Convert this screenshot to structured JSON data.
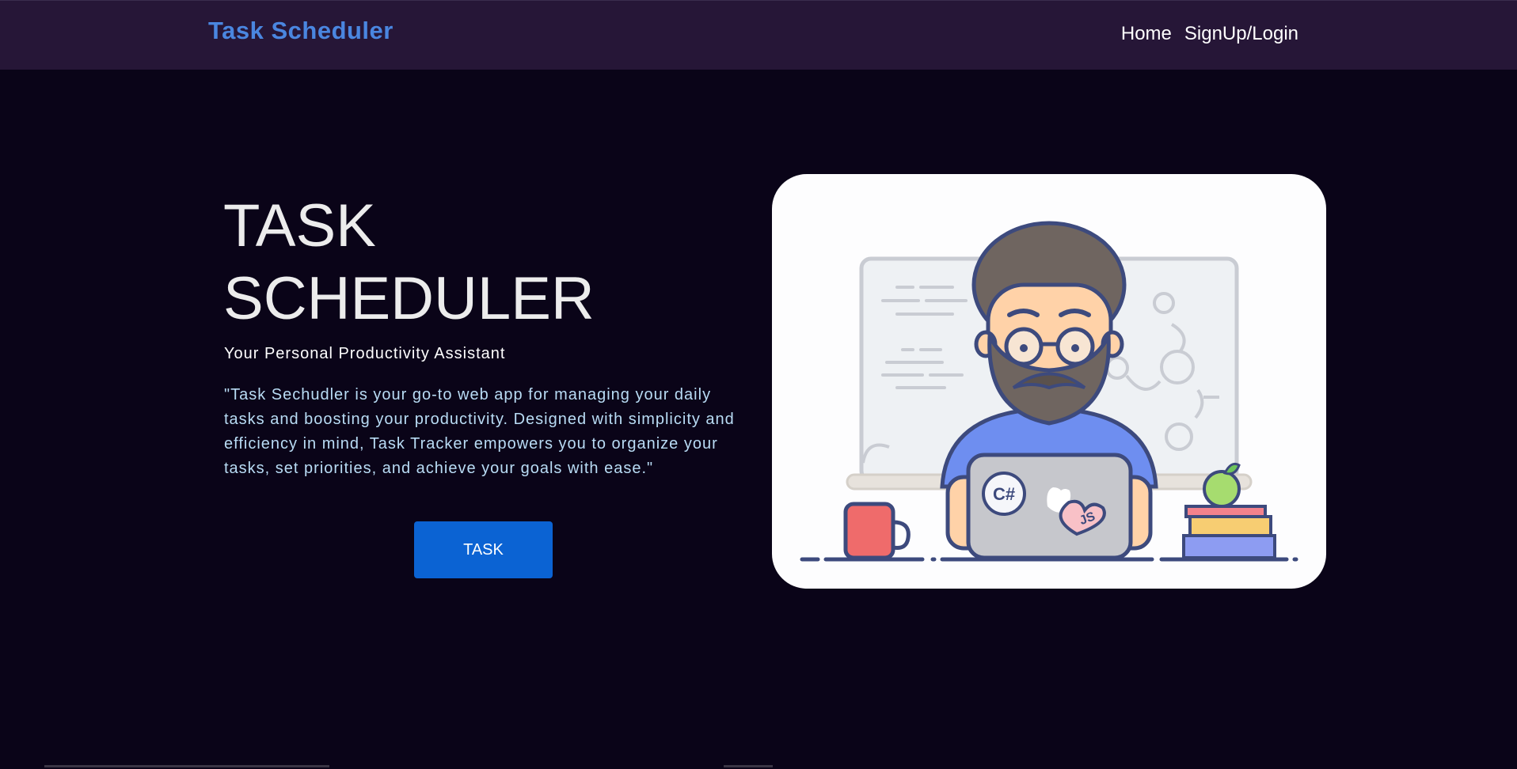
{
  "navbar": {
    "brand": "Task Scheduler",
    "links": [
      "Home",
      "SignUp/Login"
    ]
  },
  "hero": {
    "title_line1": "TASK",
    "title_line2": "SCHEDULER",
    "subtitle": "Your Personal Productivity Assistant",
    "description": "\"Task Sechudler is your go-to web app for managing your daily tasks and boosting your productivity. Designed with simplicity and efficiency in mind, Task Tracker empowers you to organize your tasks, set priorities, and achieve your goals with ease.\"",
    "button_label": "TASK"
  },
  "illustration": {
    "laptop_badge_1": "C#",
    "laptop_badge_2": "JS"
  },
  "colors": {
    "page_bg": "#0a0418",
    "navbar_bg": "#261637",
    "brand": "#4a86e0",
    "button": "#0b63d3",
    "description_text": "#b9dcf5"
  }
}
